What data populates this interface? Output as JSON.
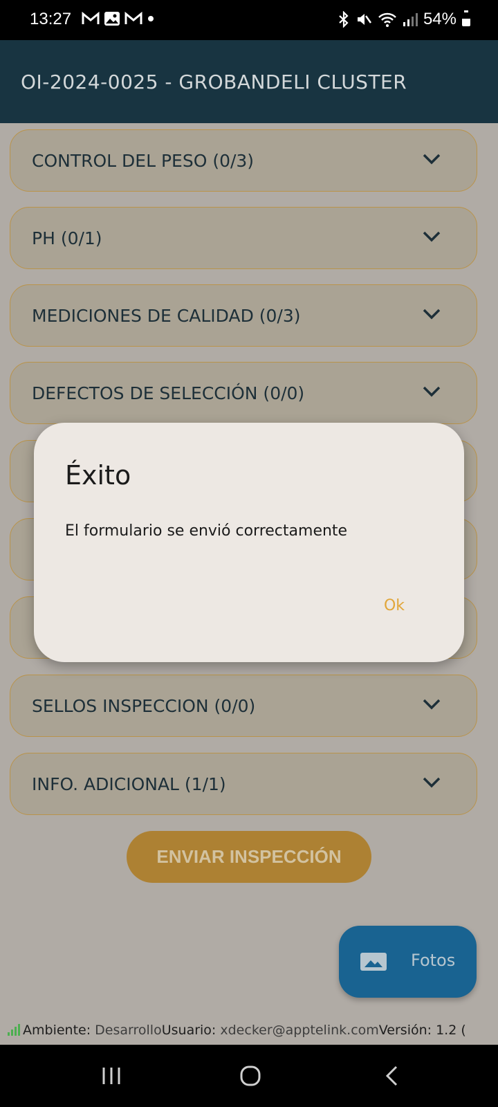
{
  "status_bar": {
    "time": "13:27",
    "left_icons": [
      "gmail-icon",
      "gallery-icon",
      "gmail-icon",
      "dot-icon"
    ],
    "right_icons": [
      "bluetooth-icon",
      "mute-icon",
      "wifi-icon",
      "signal-icon"
    ],
    "battery": "54%"
  },
  "app_bar": {
    "title": "OI-2024-0025 - GROBANDELI CLUSTER"
  },
  "sections": [
    {
      "label": "CONTROL DEL PESO (0/3)"
    },
    {
      "label": "PH (0/1)"
    },
    {
      "label": "MEDICIONES DE CALIDAD (0/3)"
    },
    {
      "label": "DEFECTOS DE SELECCIÓN (0/0)"
    },
    {
      "label": ""
    },
    {
      "label": ""
    },
    {
      "label": ""
    },
    {
      "label": "SELLOS INSPECCION (0/0)"
    },
    {
      "label": "INFO. ADICIONAL (1/1)"
    }
  ],
  "send_button": {
    "label": "ENVIAR INSPECCIÓN"
  },
  "fab": {
    "label": "Fotos",
    "icon": "image-icon"
  },
  "footer": {
    "env_label": "Ambiente: ",
    "env_value": "Desarrollo",
    "user_label": "Usuario: ",
    "user_value": "xdecker@apptelink.com",
    "version_label": "Versión: 1.2 ("
  },
  "dialog": {
    "title": "Éxito",
    "message": "El formulario se envió correctamente",
    "ok_label": "Ok"
  },
  "colors": {
    "app_bar": "#183441",
    "accent": "#e1a63a",
    "fab": "#196391"
  }
}
